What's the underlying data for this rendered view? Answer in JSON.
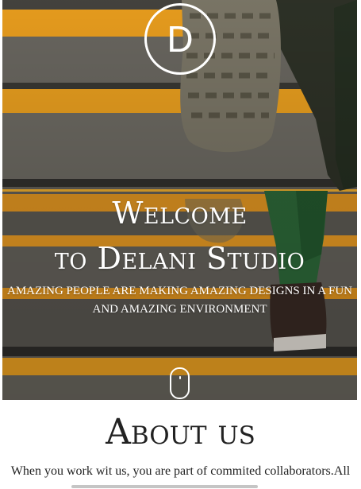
{
  "hero": {
    "logo_letter": "D",
    "title_line1": "Welcome",
    "title_line2": "to Delani Studio",
    "subtitle": "AMAZING PEOPLE ARE MAKING AMAZING DESIGNS IN A FUN AND AMAZING ENVIRONMENT",
    "scroll_icon": "mouse-scroll-icon"
  },
  "about": {
    "heading": "About us",
    "body": "When you work wit us, you are part of commited collaborators.All"
  },
  "colors": {
    "stair_stripe": "#f3a21d",
    "stair_dark": "#3d3c39",
    "text_light": "#ffffff",
    "text_dark": "#222222"
  }
}
